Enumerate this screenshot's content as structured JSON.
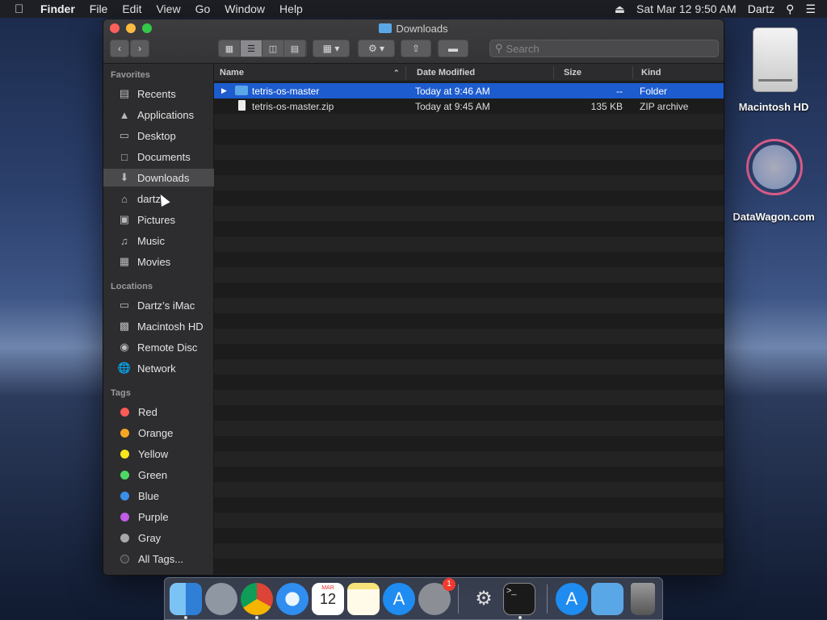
{
  "menubar": {
    "app": "Finder",
    "items": [
      "File",
      "Edit",
      "View",
      "Go",
      "Window",
      "Help"
    ],
    "datetime": "Sat Mar 12  9:50 AM",
    "user": "Dartz"
  },
  "desktop": {
    "icons": [
      {
        "label": "Macintosh HD",
        "icon": "hard-drive-icon"
      },
      {
        "label": "DataWagon.com",
        "icon": "datawagon-logo-icon"
      }
    ]
  },
  "window": {
    "title": "Downloads",
    "search_placeholder": "Search",
    "sidebar": {
      "favorites_label": "Favorites",
      "favorites": [
        {
          "label": "Recents",
          "icon": "recents-icon"
        },
        {
          "label": "Applications",
          "icon": "applications-icon"
        },
        {
          "label": "Desktop",
          "icon": "desktop-icon"
        },
        {
          "label": "Documents",
          "icon": "documents-icon"
        },
        {
          "label": "Downloads",
          "icon": "downloads-icon",
          "selected": true
        },
        {
          "label": "dartz",
          "icon": "home-icon"
        },
        {
          "label": "Pictures",
          "icon": "camera-icon"
        },
        {
          "label": "Music",
          "icon": "music-icon"
        },
        {
          "label": "Movies",
          "icon": "film-icon"
        }
      ],
      "locations_label": "Locations",
      "locations": [
        {
          "label": "Dartz’s iMac",
          "icon": "imac-icon"
        },
        {
          "label": "Macintosh HD",
          "icon": "disk-icon"
        },
        {
          "label": "Remote Disc",
          "icon": "disc-icon"
        },
        {
          "label": "Network",
          "icon": "network-icon"
        }
      ],
      "tags_label": "Tags",
      "tags": [
        {
          "label": "Red",
          "color": "#fc5b57"
        },
        {
          "label": "Orange",
          "color": "#f5a623"
        },
        {
          "label": "Yellow",
          "color": "#f8e71c"
        },
        {
          "label": "Green",
          "color": "#4cd964"
        },
        {
          "label": "Blue",
          "color": "#3b8eea"
        },
        {
          "label": "Purple",
          "color": "#c15de8"
        },
        {
          "label": "Gray",
          "color": "#a8a8a8"
        },
        {
          "label": "All Tags...",
          "color": "#3a3a3a"
        }
      ]
    },
    "columns": {
      "name": "Name",
      "date": "Date Modified",
      "size": "Size",
      "kind": "Kind"
    },
    "files": [
      {
        "name": "tetris-os-master",
        "date": "Today at 9:46 AM",
        "size": "--",
        "kind": "Folder",
        "selected": true,
        "type": "folder"
      },
      {
        "name": "tetris-os-master.zip",
        "date": "Today at 9:45 AM",
        "size": "135 KB",
        "kind": "ZIP archive",
        "selected": false,
        "type": "zip"
      }
    ]
  },
  "dock": {
    "apps": [
      "Finder",
      "Launchpad",
      "Chrome",
      "Safari",
      "Calendar",
      "Notes",
      "App Store",
      "System Preferences",
      "Wireless Diagnostics",
      "Terminal",
      "App Store",
      "Downloads",
      "Trash"
    ],
    "calendar_month": "MAR",
    "calendar_day": "12",
    "sysprefs_badge": "1"
  }
}
